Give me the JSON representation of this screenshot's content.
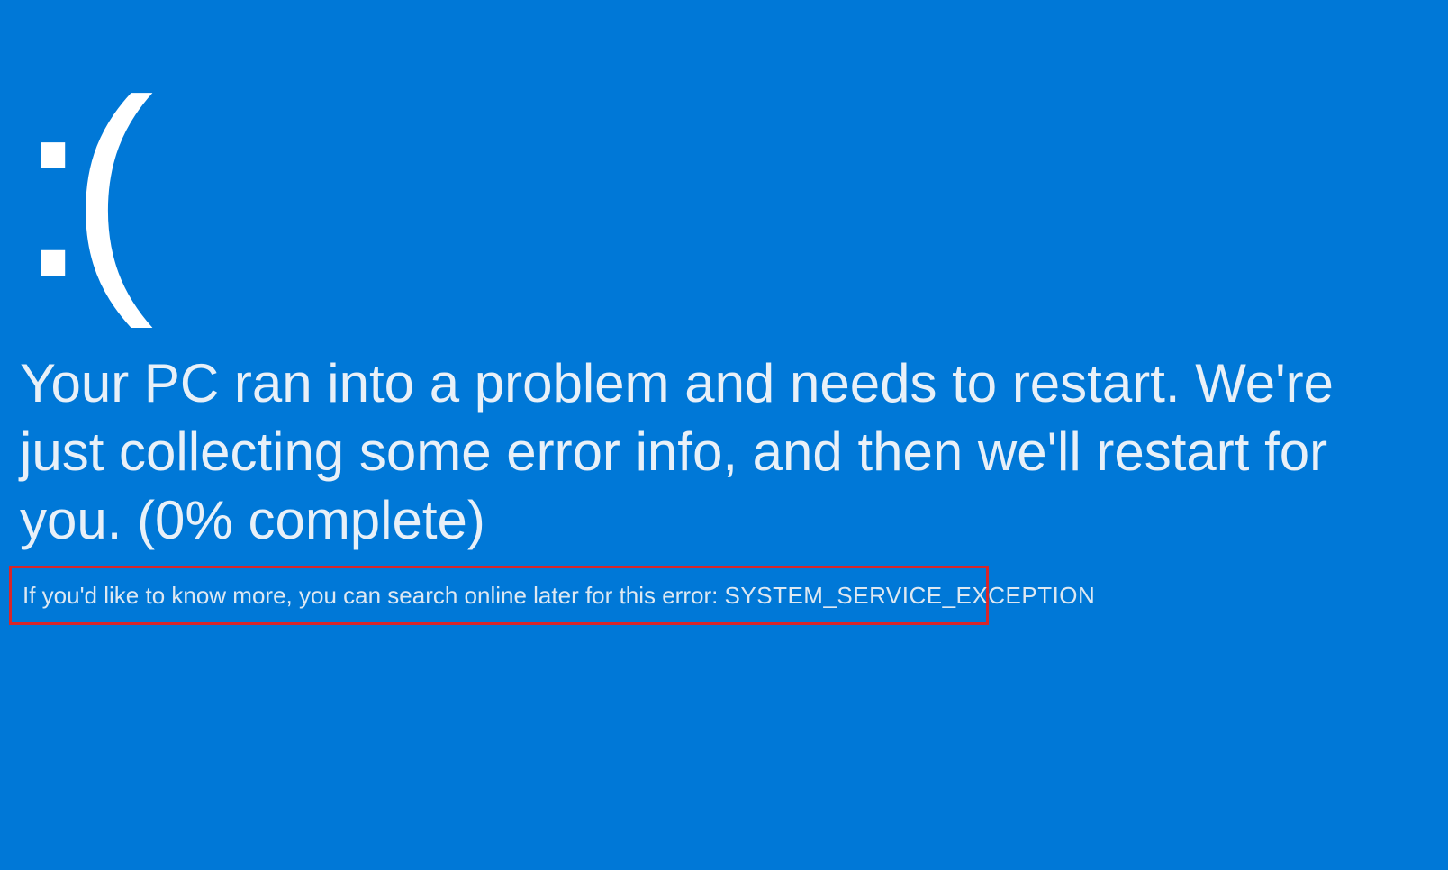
{
  "bsod": {
    "sad_face": ":(",
    "message": "Your PC ran into a problem and needs to restart. We're just collecting some error info, and then we'll restart for you. (0% complete)",
    "error_prefix": "If you'd like to know more, you can search online later for this error:  ",
    "error_code": "SYSTEM_SERVICE_EXCEPTION",
    "highlight_color": "#d8262a",
    "background_color": "#0078d7"
  }
}
